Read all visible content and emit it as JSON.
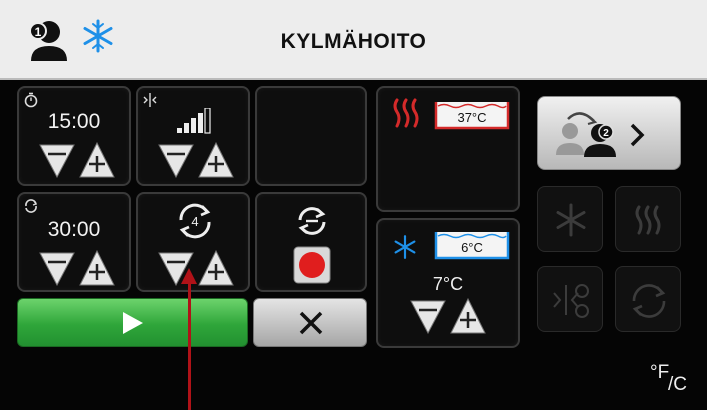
{
  "header": {
    "title": "KYLMÄHOITO",
    "user_number": "1"
  },
  "timer1": {
    "value": "15:00"
  },
  "timer2": {
    "value": "30:00"
  },
  "cycle": {
    "count": "4"
  },
  "heat_reservoir": {
    "temp": "37°C"
  },
  "cold_reservoir": {
    "temp": "6°C",
    "setpoint": "7°C"
  },
  "switch_user": {
    "user_number": "2"
  },
  "units_toggle": {
    "f_label": "°F",
    "c_label": "/C"
  },
  "colors": {
    "heat_red": "#d42a2a",
    "cold_blue": "#1e90e8",
    "start_green": "#2fa63a",
    "record_red": "#e01e1e",
    "annotation_arrow": "#b01218"
  }
}
